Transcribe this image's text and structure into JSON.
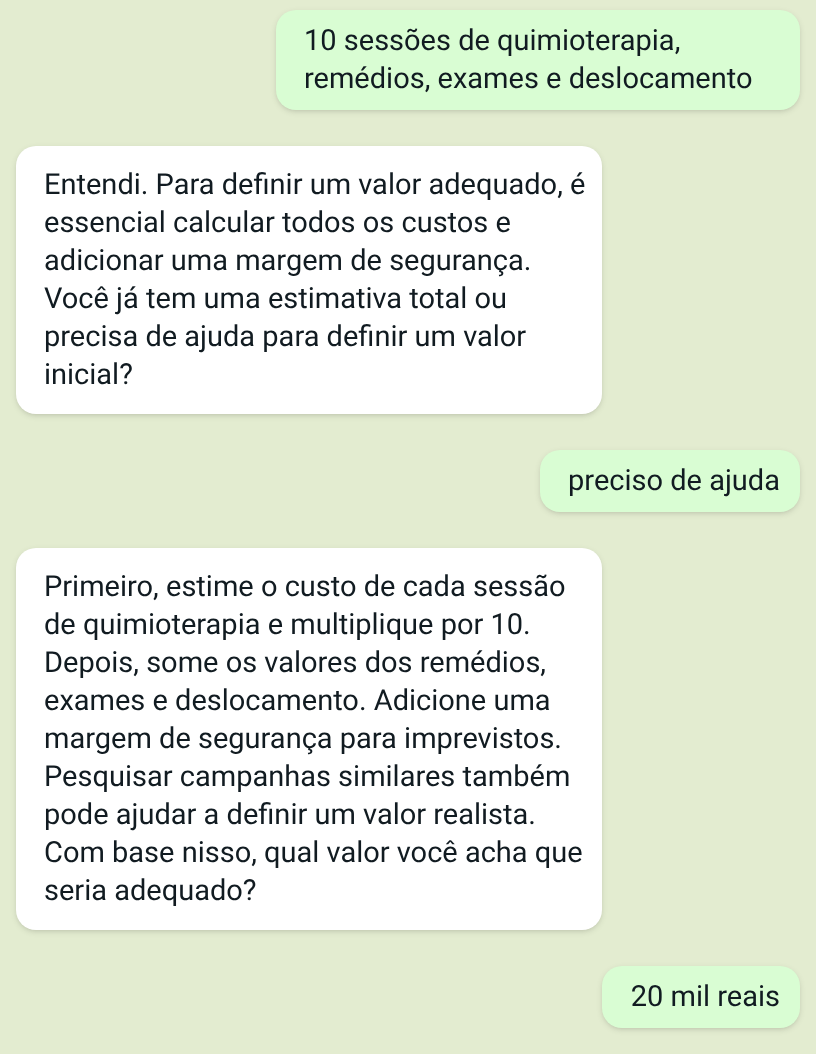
{
  "messages": [
    {
      "kind": "outgoing",
      "text": "10 sessões de quimioterapia, remédios, exames e deslocamento"
    },
    {
      "kind": "incoming",
      "text": "Entendi. Para definir um valor adequado, é essencial calcular todos os custos e adicionar uma margem de segurança. Você já tem uma estimativa total ou precisa de ajuda para definir um valor inicial?"
    },
    {
      "kind": "outgoing",
      "text": "preciso de ajuda"
    },
    {
      "kind": "incoming",
      "text": "Primeiro, estime o custo de cada sessão de quimioterapia e multiplique por 10. Depois, some os valores dos remédios, exames e deslocamento. Adicione uma margem de segurança para imprevistos. Pesquisar campanhas similares também pode ajudar a definir um valor realista. Com base nisso, qual valor você acha que seria adequado?"
    },
    {
      "kind": "outgoing",
      "text": "20 mil reais"
    }
  ]
}
